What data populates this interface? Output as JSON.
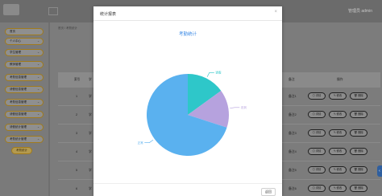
{
  "topbar": {
    "user_label": "管理员 admin",
    "user_icon": "user-icon",
    "exit_icon": "exit-icon"
  },
  "sidebar": {
    "items": [
      {
        "label": "首页"
      },
      {
        "label": "个人中心"
      },
      {
        "label": "学生管理"
      },
      {
        "label": "教师管理"
      },
      {
        "label": "考勤信息管理"
      },
      {
        "label": "请假信息管理"
      },
      {
        "label": "考勤信息管理"
      },
      {
        "label": "请假信息管理"
      },
      {
        "label": "请假统计管理"
      },
      {
        "label": "考勤统计管理"
      }
    ],
    "active_label": "考勤统计"
  },
  "breadcrumb": {
    "home": "首页",
    "sep": "/",
    "current": "考勤统计"
  },
  "table": {
    "headers": {
      "index": "索引",
      "name": "学",
      "remark": "备注",
      "actions": "操作"
    },
    "rows": [
      {
        "index": "1",
        "name": "学",
        "remark": "备注1"
      },
      {
        "index": "2",
        "name": "学",
        "remark": "备注2"
      },
      {
        "index": "3",
        "name": "学",
        "remark": "备注3"
      },
      {
        "index": "4",
        "name": "学",
        "remark": "备注4"
      },
      {
        "index": "5",
        "name": "学",
        "remark": "备注5"
      },
      {
        "index": "6",
        "name": "学",
        "remark": "备注6"
      }
    ],
    "btn_detail": "详情",
    "btn_edit": "修改",
    "btn_delete": "删除"
  },
  "modal": {
    "title": "统计报表",
    "close": "×",
    "back": "返回"
  },
  "chart_data": {
    "type": "pie",
    "title": "考勤统计",
    "slices": [
      {
        "label": "请假",
        "value": 15,
        "color": "#2ec7c9"
      },
      {
        "label": "迟到",
        "value": 15,
        "color": "#b6a2de"
      },
      {
        "label": "正常",
        "value": 70,
        "color": "#5ab1ef"
      }
    ]
  }
}
